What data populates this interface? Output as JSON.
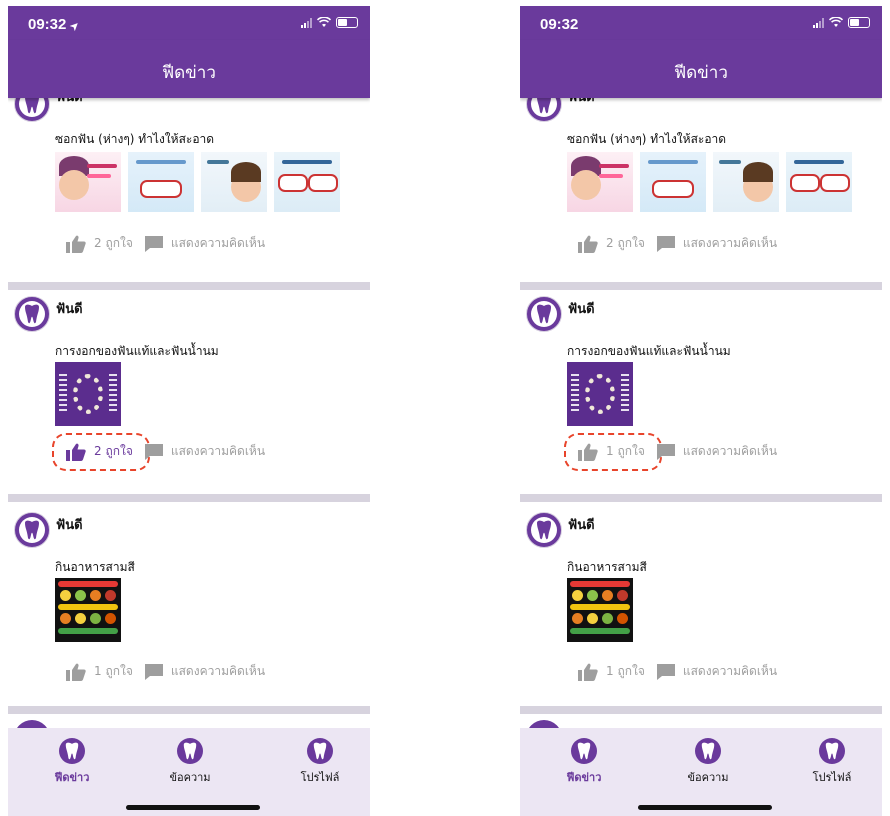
{
  "screens": [
    {
      "status": {
        "time": "09:32",
        "location_arrow": "➤"
      },
      "nav": {
        "title": "ฟีดข่าว"
      },
      "posts": [
        {
          "author": "ฟันดี",
          "caption": "ซอกฟัน (ห่างๆ) ทำไงให้สะอาด",
          "likes": "2 ถูกใจ",
          "comment": "แสดงความคิดเห็น",
          "liked": false
        },
        {
          "author": "ฟันดี",
          "caption": "การงอกของฟันแท้และฟันน้ำนม",
          "likes": "2 ถูกใจ",
          "comment": "แสดงความคิดเห็น",
          "liked": true
        },
        {
          "author": "ฟันดี",
          "caption": "กินอาหารสามสี",
          "likes": "1 ถูกใจ",
          "comment": "แสดงความคิดเห็น",
          "liked": false
        }
      ],
      "tabs": [
        {
          "label": "ฟีดข่าว",
          "icon": "tooth-icon",
          "active": true
        },
        {
          "label": "ข้อความ",
          "icon": "tooth-icon",
          "active": false
        },
        {
          "label": "โปรไฟล์",
          "icon": "tooth-icon",
          "active": false
        }
      ]
    },
    {
      "status": {
        "time": "09:32",
        "location_arrow": ""
      },
      "nav": {
        "title": "ฟีดข่าว"
      },
      "posts": [
        {
          "author": "ฟันดี",
          "caption": "ซอกฟัน (ห่างๆ) ทำไงให้สะอาด",
          "likes": "2 ถูกใจ",
          "comment": "แสดงความคิดเห็น",
          "liked": false
        },
        {
          "author": "ฟันดี",
          "caption": "การงอกของฟันแท้และฟันน้ำนม",
          "likes": "1 ถูกใจ",
          "comment": "แสดงความคิดเห็น",
          "liked": false
        },
        {
          "author": "ฟันดี",
          "caption": "กินอาหารสามสี",
          "likes": "1 ถูกใจ",
          "comment": "แสดงความคิดเห็น",
          "liked": false
        }
      ],
      "tabs": [
        {
          "label": "ฟีดข่าว",
          "icon": "tooth-icon",
          "active": true
        },
        {
          "label": "ข้อความ",
          "icon": "tooth-icon",
          "active": false
        },
        {
          "label": "โปรไฟล์",
          "icon": "tooth-icon",
          "active": false
        }
      ]
    }
  ],
  "colors": {
    "brand": "#6a3a9c",
    "separator": "#d7d3de",
    "highlight": "#e8442b",
    "muted": "#9e9e9e",
    "tabbar": "#ece6f3"
  }
}
